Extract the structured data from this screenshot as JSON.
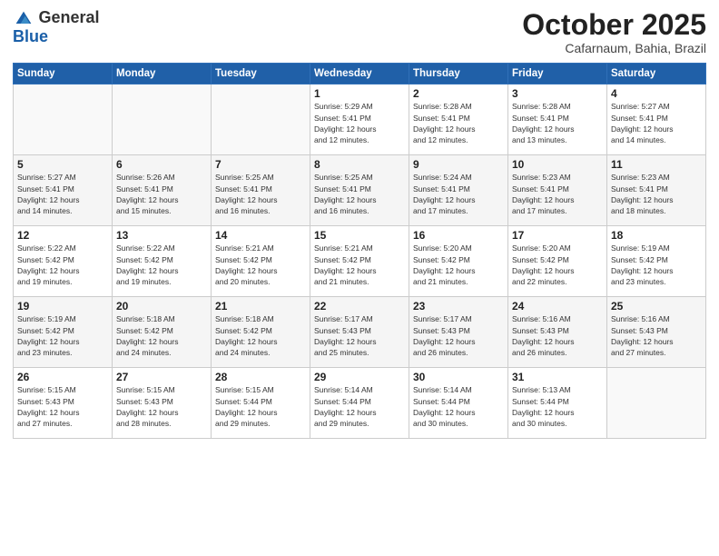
{
  "header": {
    "logo_general": "General",
    "logo_blue": "Blue",
    "month": "October 2025",
    "location": "Cafarnaum, Bahia, Brazil"
  },
  "weekdays": [
    "Sunday",
    "Monday",
    "Tuesday",
    "Wednesday",
    "Thursday",
    "Friday",
    "Saturday"
  ],
  "weeks": [
    [
      {
        "day": "",
        "info": ""
      },
      {
        "day": "",
        "info": ""
      },
      {
        "day": "",
        "info": ""
      },
      {
        "day": "1",
        "info": "Sunrise: 5:29 AM\nSunset: 5:41 PM\nDaylight: 12 hours\nand 12 minutes."
      },
      {
        "day": "2",
        "info": "Sunrise: 5:28 AM\nSunset: 5:41 PM\nDaylight: 12 hours\nand 12 minutes."
      },
      {
        "day": "3",
        "info": "Sunrise: 5:28 AM\nSunset: 5:41 PM\nDaylight: 12 hours\nand 13 minutes."
      },
      {
        "day": "4",
        "info": "Sunrise: 5:27 AM\nSunset: 5:41 PM\nDaylight: 12 hours\nand 14 minutes."
      }
    ],
    [
      {
        "day": "5",
        "info": "Sunrise: 5:27 AM\nSunset: 5:41 PM\nDaylight: 12 hours\nand 14 minutes."
      },
      {
        "day": "6",
        "info": "Sunrise: 5:26 AM\nSunset: 5:41 PM\nDaylight: 12 hours\nand 15 minutes."
      },
      {
        "day": "7",
        "info": "Sunrise: 5:25 AM\nSunset: 5:41 PM\nDaylight: 12 hours\nand 16 minutes."
      },
      {
        "day": "8",
        "info": "Sunrise: 5:25 AM\nSunset: 5:41 PM\nDaylight: 12 hours\nand 16 minutes."
      },
      {
        "day": "9",
        "info": "Sunrise: 5:24 AM\nSunset: 5:41 PM\nDaylight: 12 hours\nand 17 minutes."
      },
      {
        "day": "10",
        "info": "Sunrise: 5:23 AM\nSunset: 5:41 PM\nDaylight: 12 hours\nand 17 minutes."
      },
      {
        "day": "11",
        "info": "Sunrise: 5:23 AM\nSunset: 5:41 PM\nDaylight: 12 hours\nand 18 minutes."
      }
    ],
    [
      {
        "day": "12",
        "info": "Sunrise: 5:22 AM\nSunset: 5:42 PM\nDaylight: 12 hours\nand 19 minutes."
      },
      {
        "day": "13",
        "info": "Sunrise: 5:22 AM\nSunset: 5:42 PM\nDaylight: 12 hours\nand 19 minutes."
      },
      {
        "day": "14",
        "info": "Sunrise: 5:21 AM\nSunset: 5:42 PM\nDaylight: 12 hours\nand 20 minutes."
      },
      {
        "day": "15",
        "info": "Sunrise: 5:21 AM\nSunset: 5:42 PM\nDaylight: 12 hours\nand 21 minutes."
      },
      {
        "day": "16",
        "info": "Sunrise: 5:20 AM\nSunset: 5:42 PM\nDaylight: 12 hours\nand 21 minutes."
      },
      {
        "day": "17",
        "info": "Sunrise: 5:20 AM\nSunset: 5:42 PM\nDaylight: 12 hours\nand 22 minutes."
      },
      {
        "day": "18",
        "info": "Sunrise: 5:19 AM\nSunset: 5:42 PM\nDaylight: 12 hours\nand 23 minutes."
      }
    ],
    [
      {
        "day": "19",
        "info": "Sunrise: 5:19 AM\nSunset: 5:42 PM\nDaylight: 12 hours\nand 23 minutes."
      },
      {
        "day": "20",
        "info": "Sunrise: 5:18 AM\nSunset: 5:42 PM\nDaylight: 12 hours\nand 24 minutes."
      },
      {
        "day": "21",
        "info": "Sunrise: 5:18 AM\nSunset: 5:42 PM\nDaylight: 12 hours\nand 24 minutes."
      },
      {
        "day": "22",
        "info": "Sunrise: 5:17 AM\nSunset: 5:43 PM\nDaylight: 12 hours\nand 25 minutes."
      },
      {
        "day": "23",
        "info": "Sunrise: 5:17 AM\nSunset: 5:43 PM\nDaylight: 12 hours\nand 26 minutes."
      },
      {
        "day": "24",
        "info": "Sunrise: 5:16 AM\nSunset: 5:43 PM\nDaylight: 12 hours\nand 26 minutes."
      },
      {
        "day": "25",
        "info": "Sunrise: 5:16 AM\nSunset: 5:43 PM\nDaylight: 12 hours\nand 27 minutes."
      }
    ],
    [
      {
        "day": "26",
        "info": "Sunrise: 5:15 AM\nSunset: 5:43 PM\nDaylight: 12 hours\nand 27 minutes."
      },
      {
        "day": "27",
        "info": "Sunrise: 5:15 AM\nSunset: 5:43 PM\nDaylight: 12 hours\nand 28 minutes."
      },
      {
        "day": "28",
        "info": "Sunrise: 5:15 AM\nSunset: 5:44 PM\nDaylight: 12 hours\nand 29 minutes."
      },
      {
        "day": "29",
        "info": "Sunrise: 5:14 AM\nSunset: 5:44 PM\nDaylight: 12 hours\nand 29 minutes."
      },
      {
        "day": "30",
        "info": "Sunrise: 5:14 AM\nSunset: 5:44 PM\nDaylight: 12 hours\nand 30 minutes."
      },
      {
        "day": "31",
        "info": "Sunrise: 5:13 AM\nSunset: 5:44 PM\nDaylight: 12 hours\nand 30 minutes."
      },
      {
        "day": "",
        "info": ""
      }
    ]
  ]
}
